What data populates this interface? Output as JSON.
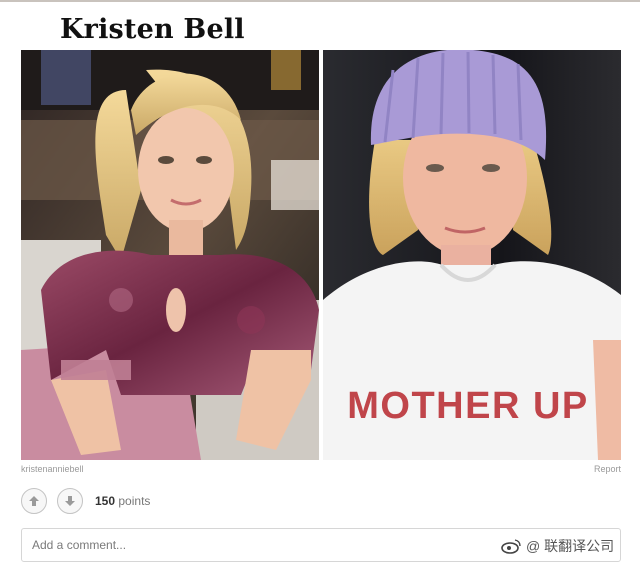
{
  "post": {
    "title": "Kristen Bell",
    "shirt_text": "MOTHER UP",
    "credit": "kristenanniebell",
    "report_label": "Report",
    "points_count": "150",
    "points_label": "points"
  },
  "comment": {
    "placeholder": "Add a comment..."
  },
  "watermark": {
    "text": "@ 联翻译公司"
  },
  "colors": {
    "shirt_text": "#c0454a",
    "beanie": "#a99ad6",
    "velvet_top": "#7d2f49"
  }
}
